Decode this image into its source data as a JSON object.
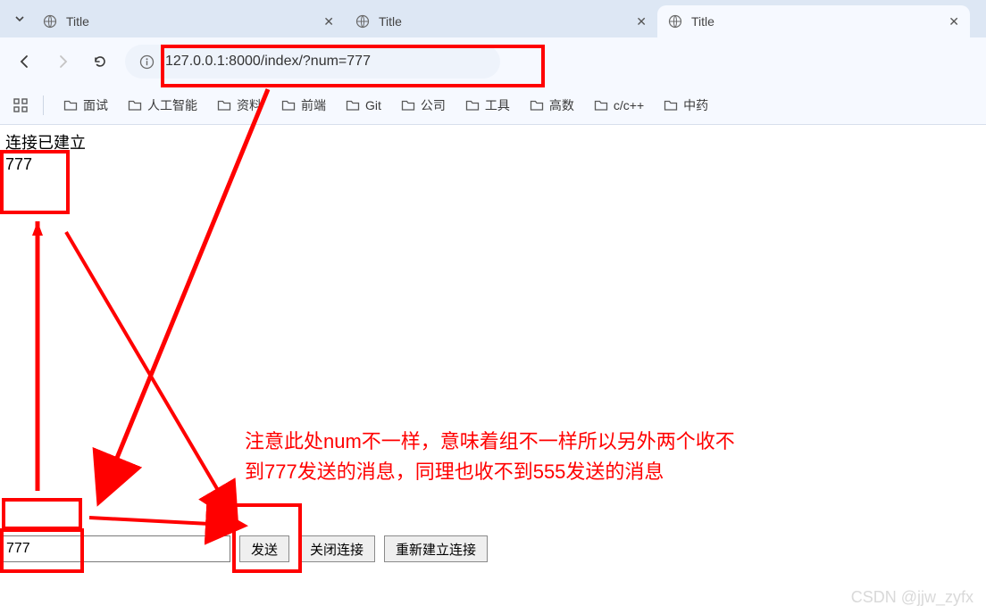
{
  "tabs": [
    {
      "title": "Title"
    },
    {
      "title": "Title"
    },
    {
      "title": "Title"
    }
  ],
  "url": "127.0.0.1:8000/index/?num=777",
  "bookmarks": [
    "面试",
    "人工智能",
    "资料",
    "前端",
    "Git",
    "公司",
    "工具",
    "高数",
    "c/c++",
    "中药"
  ],
  "page": {
    "line1": "连接已建立",
    "line2": "777"
  },
  "controls": {
    "input_value": "777",
    "send": "发送",
    "close_conn": "关闭连接",
    "reconnect": "重新建立连接"
  },
  "annotation": {
    "line1": "注意此处num不一样，意味着组不一样所以另外两个收不",
    "line2": "到777发送的消息，同理也收不到555发送的消息"
  },
  "watermark": "CSDN @jjw_zyfx"
}
